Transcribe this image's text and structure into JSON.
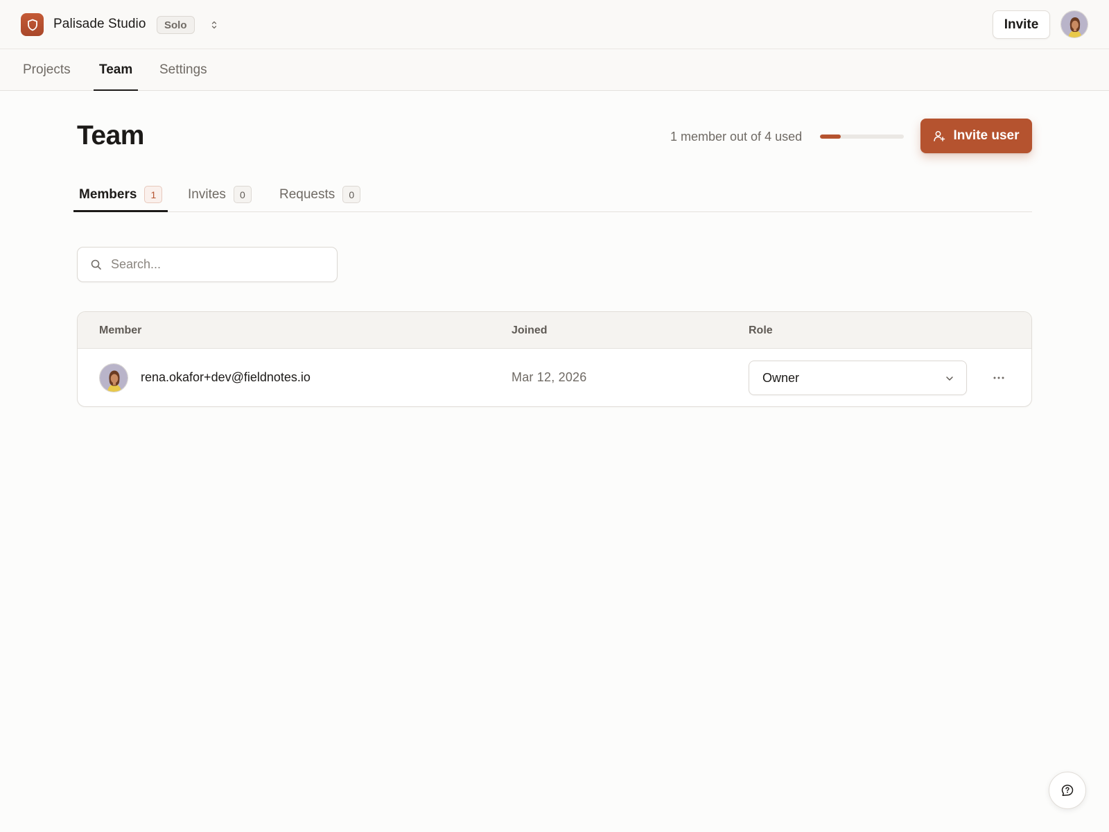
{
  "header": {
    "workspace_name": "Palisade Studio",
    "plan_badge": "Solo",
    "invite_label": "Invite",
    "logo_icon": "shield-icon",
    "switcher_icon": "chevron-up-down-icon",
    "avatar_icon": "user-avatar"
  },
  "nav": {
    "tabs": [
      {
        "label": "Projects",
        "active": false
      },
      {
        "label": "Team",
        "active": true
      },
      {
        "label": "Settings",
        "active": false
      }
    ]
  },
  "page": {
    "title": "Team",
    "usage_text": "1 member out of 4 used",
    "usage_fraction": 0.25,
    "invite_user_label": "Invite user",
    "invite_user_icon": "user-plus-icon"
  },
  "subtabs": [
    {
      "label": "Members",
      "count": "1",
      "active": true
    },
    {
      "label": "Invites",
      "count": "0",
      "active": false
    },
    {
      "label": "Requests",
      "count": "0",
      "active": false
    }
  ],
  "search": {
    "placeholder": "Search...",
    "value": "",
    "icon": "search-icon"
  },
  "table": {
    "columns": [
      "Member",
      "Joined",
      "Role"
    ],
    "rows": [
      {
        "email": "rena.okafor+dev@fieldnotes.io",
        "joined": "Mar 12, 2026",
        "role": "Owner",
        "menu_icon": "more-horizontal-icon"
      }
    ]
  },
  "help": {
    "icon": "help-chat-icon"
  },
  "colors": {
    "accent": "#b5532f",
    "background": "#fcfcfb",
    "text": "#1c1a18",
    "muted": "#6f6a64"
  }
}
